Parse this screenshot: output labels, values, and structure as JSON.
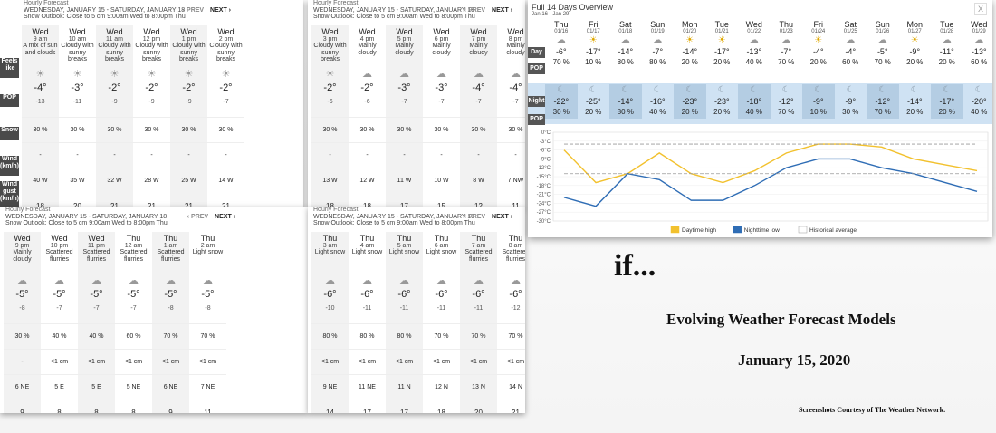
{
  "hourly_panels": [
    {
      "title": "Hourly Forecast",
      "range": "WEDNESDAY, JANUARY 15 - SATURDAY, JANUARY 18",
      "outlook": "Snow Outlook: Close to 5 cm 9:00am Wed to 8:00pm Thu",
      "prev": "‹ PREV",
      "next": "NEXT ›",
      "cols": [
        {
          "day": "Wed",
          "hr": "9 am",
          "cond": "A mix of sun and clouds",
          "temp": "-4°",
          "fl": "-13",
          "pop": "30 %",
          "snow": "-",
          "wind": "40 W",
          "gust": "18"
        },
        {
          "day": "Wed",
          "hr": "10 am",
          "cond": "Cloudy with sunny breaks",
          "temp": "-3°",
          "fl": "-11",
          "pop": "30 %",
          "snow": "-",
          "wind": "35 W",
          "gust": "20"
        },
        {
          "day": "Wed",
          "hr": "11 am",
          "cond": "Cloudy with sunny breaks",
          "temp": "-2°",
          "fl": "-9",
          "pop": "30 %",
          "snow": "-",
          "wind": "32 W",
          "gust": "21"
        },
        {
          "day": "Wed",
          "hr": "12 pm",
          "cond": "Cloudy with sunny breaks",
          "temp": "-2°",
          "fl": "-9",
          "pop": "30 %",
          "snow": "-",
          "wind": "28 W",
          "gust": "21"
        },
        {
          "day": "Wed",
          "hr": "1 pm",
          "cond": "Cloudy with sunny breaks",
          "temp": "-2°",
          "fl": "-9",
          "pop": "30 %",
          "snow": "-",
          "wind": "25 W",
          "gust": "21"
        },
        {
          "day": "Wed",
          "hr": "2 pm",
          "cond": "Cloudy with sunny breaks",
          "temp": "-2°",
          "fl": "-7",
          "pop": "30 %",
          "snow": "-",
          "wind": "14 W",
          "gust": "21"
        }
      ]
    },
    {
      "title": "Hourly Forecast",
      "range": "WEDNESDAY, JANUARY 15 - SATURDAY, JANUARY 18",
      "outlook": "Snow Outlook: Close to 5 cm 9:00am Wed to 8:00pm Thu",
      "prev": "‹ PREV",
      "next": "NEXT ›",
      "cols": [
        {
          "day": "Wed",
          "hr": "3 pm",
          "cond": "Cloudy with sunny breaks",
          "temp": "-2°",
          "fl": "-6",
          "pop": "30 %",
          "snow": "-",
          "wind": "13 W",
          "gust": "18"
        },
        {
          "day": "Wed",
          "hr": "4 pm",
          "cond": "Mainly cloudy",
          "temp": "-2°",
          "fl": "-6",
          "pop": "30 %",
          "snow": "-",
          "wind": "12 W",
          "gust": "18"
        },
        {
          "day": "Wed",
          "hr": "5 pm",
          "cond": "Mainly cloudy",
          "temp": "-3°",
          "fl": "-7",
          "pop": "30 %",
          "snow": "-",
          "wind": "11 W",
          "gust": "17"
        },
        {
          "day": "Wed",
          "hr": "6 pm",
          "cond": "Mainly cloudy",
          "temp": "-3°",
          "fl": "-7",
          "pop": "30 %",
          "snow": "-",
          "wind": "10 W",
          "gust": "15"
        },
        {
          "day": "Wed",
          "hr": "7 pm",
          "cond": "Mainly cloudy",
          "temp": "-4°",
          "fl": "-7",
          "pop": "30 %",
          "snow": "-",
          "wind": "8 W",
          "gust": "12"
        },
        {
          "day": "Wed",
          "hr": "8 pm",
          "cond": "Mainly cloudy",
          "temp": "-4°",
          "fl": "-7",
          "pop": "30 %",
          "snow": "-",
          "wind": "7 NW",
          "gust": "11"
        }
      ]
    },
    {
      "title": "Hourly Forecast",
      "range": "WEDNESDAY, JANUARY 15 - SATURDAY, JANUARY 18",
      "outlook": "Snow Outlook: Close to 5 cm 9:00am Wed to 8:00pm Thu",
      "prev": "‹ PREV",
      "next": "NEXT ›",
      "cols": [
        {
          "day": "Wed",
          "hr": "9 pm",
          "cond": "Mainly cloudy",
          "temp": "-5°",
          "fl": "-8",
          "pop": "30 %",
          "snow": "-",
          "wind": "6 NE",
          "gust": "9"
        },
        {
          "day": "Wed",
          "hr": "10 pm",
          "cond": "Scattered flurries",
          "temp": "-5°",
          "fl": "-7",
          "pop": "40 %",
          "snow": "<1 cm",
          "wind": "5 E",
          "gust": "8"
        },
        {
          "day": "Wed",
          "hr": "11 pm",
          "cond": "Scattered flurries",
          "temp": "-5°",
          "fl": "-7",
          "pop": "40 %",
          "snow": "<1 cm",
          "wind": "5 E",
          "gust": "8"
        },
        {
          "day": "Thu",
          "hr": "12 am",
          "cond": "Scattered flurries",
          "temp": "-5°",
          "fl": "-7",
          "pop": "60 %",
          "snow": "<1 cm",
          "wind": "5 NE",
          "gust": "8"
        },
        {
          "day": "Thu",
          "hr": "1 am",
          "cond": "Scattered flurries",
          "temp": "-5°",
          "fl": "-8",
          "pop": "70 %",
          "snow": "<1 cm",
          "wind": "6 NE",
          "gust": "9"
        },
        {
          "day": "Thu",
          "hr": "2 am",
          "cond": "Light snow",
          "temp": "-5°",
          "fl": "-8",
          "pop": "70 %",
          "snow": "<1 cm",
          "wind": "7 NE",
          "gust": "11"
        }
      ]
    },
    {
      "title": "Hourly Forecast",
      "range": "WEDNESDAY, JANUARY 15 - SATURDAY, JANUARY 18",
      "outlook": "Snow Outlook: Close to 5 cm 9:00am Wed to 8:00pm Thu",
      "prev": "‹ PREV",
      "next": "NEXT ›",
      "cols": [
        {
          "day": "Thu",
          "hr": "3 am",
          "cond": "Light snow",
          "temp": "-6°",
          "fl": "-10",
          "pop": "80 %",
          "snow": "<1 cm",
          "wind": "9 NE",
          "gust": "14"
        },
        {
          "day": "Thu",
          "hr": "4 am",
          "cond": "Light snow",
          "temp": "-6°",
          "fl": "-11",
          "pop": "80 %",
          "snow": "<1 cm",
          "wind": "11 NE",
          "gust": "17"
        },
        {
          "day": "Thu",
          "hr": "5 am",
          "cond": "Light snow",
          "temp": "-6°",
          "fl": "-11",
          "pop": "80 %",
          "snow": "<1 cm",
          "wind": "11 N",
          "gust": "17"
        },
        {
          "day": "Thu",
          "hr": "6 am",
          "cond": "Light snow",
          "temp": "-6°",
          "fl": "-11",
          "pop": "70 %",
          "snow": "<1 cm",
          "wind": "12 N",
          "gust": "18"
        },
        {
          "day": "Thu",
          "hr": "7 am",
          "cond": "Scattered flurries",
          "temp": "-6°",
          "fl": "-11",
          "pop": "70 %",
          "snow": "<1 cm",
          "wind": "13 N",
          "gust": "20"
        },
        {
          "day": "Thu",
          "hr": "8 am",
          "cond": "Scattered flurries",
          "temp": "-6°",
          "fl": "-12",
          "pop": "70 %",
          "snow": "<1 cm",
          "wind": "14 N",
          "gust": "21"
        }
      ]
    }
  ],
  "side_labels": {
    "feels": "Feels like",
    "pop": "POP",
    "snow": "Snow",
    "wind": "Wind (km/h)",
    "gust": "Wind gust (km/h)"
  },
  "overview": {
    "title": "Full 14 Days Overview",
    "range": "Jan 16 - Jan 29",
    "close": "X",
    "day_label": "Day",
    "pop_label": "POP",
    "night_label": "Night",
    "days": [
      {
        "dn": "Thu",
        "dd": "01/16",
        "hi": "-6°",
        "pop": "70 %",
        "lo": "-22°",
        "npop": "30 %"
      },
      {
        "dn": "Fri",
        "dd": "01/17",
        "hi": "-17°",
        "pop": "10 %",
        "lo": "-25°",
        "npop": "20 %"
      },
      {
        "dn": "Sat",
        "dd": "01/18",
        "hi": "-14°",
        "pop": "80 %",
        "lo": "-14°",
        "npop": "80 %"
      },
      {
        "dn": "Sun",
        "dd": "01/19",
        "hi": "-7°",
        "pop": "80 %",
        "lo": "-16°",
        "npop": "40 %"
      },
      {
        "dn": "Mon",
        "dd": "01/20",
        "hi": "-14°",
        "pop": "20 %",
        "lo": "-23°",
        "npop": "20 %"
      },
      {
        "dn": "Tue",
        "dd": "01/21",
        "hi": "-17°",
        "pop": "20 %",
        "lo": "-23°",
        "npop": "20 %"
      },
      {
        "dn": "Wed",
        "dd": "01/22",
        "hi": "-13°",
        "pop": "40 %",
        "lo": "-18°",
        "npop": "40 %"
      },
      {
        "dn": "Thu",
        "dd": "01/23",
        "hi": "-7°",
        "pop": "70 %",
        "lo": "-12°",
        "npop": "70 %"
      },
      {
        "dn": "Fri",
        "dd": "01/24",
        "hi": "-4°",
        "pop": "20 %",
        "lo": "-9°",
        "npop": "10 %"
      },
      {
        "dn": "Sat",
        "dd": "01/25",
        "hi": "-4°",
        "pop": "60 %",
        "lo": "-9°",
        "npop": "30 %"
      },
      {
        "dn": "Sun",
        "dd": "01/26",
        "hi": "-5°",
        "pop": "70 %",
        "lo": "-12°",
        "npop": "70 %"
      },
      {
        "dn": "Mon",
        "dd": "01/27",
        "hi": "-9°",
        "pop": "20 %",
        "lo": "-14°",
        "npop": "20 %"
      },
      {
        "dn": "Tue",
        "dd": "01/28",
        "hi": "-11°",
        "pop": "20 %",
        "lo": "-17°",
        "npop": "20 %"
      },
      {
        "dn": "Wed",
        "dd": "01/29",
        "hi": "-13°",
        "pop": "60 %",
        "lo": "-20°",
        "npop": "40 %"
      }
    ]
  },
  "chart_data": {
    "type": "line",
    "categories": [
      "01/16",
      "01/17",
      "01/18",
      "01/19",
      "01/20",
      "01/21",
      "01/22",
      "01/23",
      "01/24",
      "01/25",
      "01/26",
      "01/27",
      "01/28",
      "01/29"
    ],
    "yticks": [
      "0°C",
      "-3°C",
      "-6°C",
      "-9°C",
      "-12°C",
      "-15°C",
      "-18°C",
      "-21°C",
      "-24°C",
      "-27°C",
      "-30°C"
    ],
    "ylim": [
      -30,
      0
    ],
    "series": [
      {
        "name": "Daytime high",
        "color": "#f2c12e",
        "values": [
          -6,
          -17,
          -14,
          -7,
          -14,
          -17,
          -13,
          -7,
          -4,
          -4,
          -5,
          -9,
          -11,
          -13
        ]
      },
      {
        "name": "Nighttime low",
        "color": "#2f6db5",
        "values": [
          -22,
          -25,
          -14,
          -16,
          -23,
          -23,
          -18,
          -12,
          -9,
          -9,
          -12,
          -14,
          -17,
          -20
        ]
      },
      {
        "name": "Historical average",
        "color": "#999999",
        "values": [
          -4,
          -4,
          -4,
          -4,
          -4,
          -4,
          -4,
          -4,
          -4,
          -4,
          -4,
          -4,
          -4,
          -4
        ]
      }
    ],
    "hist_low": -14
  },
  "text": {
    "if": "if...",
    "title": "Evolving Weather Forecast Models",
    "date": "January 15, 2020",
    "credit": "Screenshots Courtesy of The Weather Network."
  }
}
